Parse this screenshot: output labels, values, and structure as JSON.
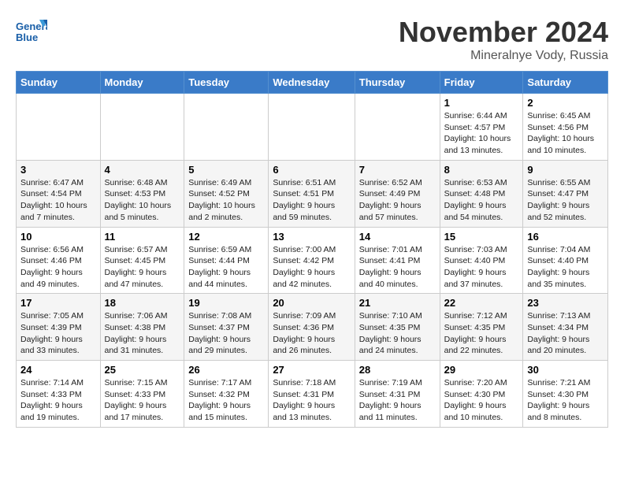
{
  "header": {
    "logo_text_general": "General",
    "logo_text_blue": "Blue",
    "month_title": "November 2024",
    "location": "Mineralnye Vody, Russia"
  },
  "days_of_week": [
    "Sunday",
    "Monday",
    "Tuesday",
    "Wednesday",
    "Thursday",
    "Friday",
    "Saturday"
  ],
  "weeks": [
    [
      {
        "day": "",
        "info": ""
      },
      {
        "day": "",
        "info": ""
      },
      {
        "day": "",
        "info": ""
      },
      {
        "day": "",
        "info": ""
      },
      {
        "day": "",
        "info": ""
      },
      {
        "day": "1",
        "info": "Sunrise: 6:44 AM\nSunset: 4:57 PM\nDaylight: 10 hours and 13 minutes."
      },
      {
        "day": "2",
        "info": "Sunrise: 6:45 AM\nSunset: 4:56 PM\nDaylight: 10 hours and 10 minutes."
      }
    ],
    [
      {
        "day": "3",
        "info": "Sunrise: 6:47 AM\nSunset: 4:54 PM\nDaylight: 10 hours and 7 minutes."
      },
      {
        "day": "4",
        "info": "Sunrise: 6:48 AM\nSunset: 4:53 PM\nDaylight: 10 hours and 5 minutes."
      },
      {
        "day": "5",
        "info": "Sunrise: 6:49 AM\nSunset: 4:52 PM\nDaylight: 10 hours and 2 minutes."
      },
      {
        "day": "6",
        "info": "Sunrise: 6:51 AM\nSunset: 4:51 PM\nDaylight: 9 hours and 59 minutes."
      },
      {
        "day": "7",
        "info": "Sunrise: 6:52 AM\nSunset: 4:49 PM\nDaylight: 9 hours and 57 minutes."
      },
      {
        "day": "8",
        "info": "Sunrise: 6:53 AM\nSunset: 4:48 PM\nDaylight: 9 hours and 54 minutes."
      },
      {
        "day": "9",
        "info": "Sunrise: 6:55 AM\nSunset: 4:47 PM\nDaylight: 9 hours and 52 minutes."
      }
    ],
    [
      {
        "day": "10",
        "info": "Sunrise: 6:56 AM\nSunset: 4:46 PM\nDaylight: 9 hours and 49 minutes."
      },
      {
        "day": "11",
        "info": "Sunrise: 6:57 AM\nSunset: 4:45 PM\nDaylight: 9 hours and 47 minutes."
      },
      {
        "day": "12",
        "info": "Sunrise: 6:59 AM\nSunset: 4:44 PM\nDaylight: 9 hours and 44 minutes."
      },
      {
        "day": "13",
        "info": "Sunrise: 7:00 AM\nSunset: 4:42 PM\nDaylight: 9 hours and 42 minutes."
      },
      {
        "day": "14",
        "info": "Sunrise: 7:01 AM\nSunset: 4:41 PM\nDaylight: 9 hours and 40 minutes."
      },
      {
        "day": "15",
        "info": "Sunrise: 7:03 AM\nSunset: 4:40 PM\nDaylight: 9 hours and 37 minutes."
      },
      {
        "day": "16",
        "info": "Sunrise: 7:04 AM\nSunset: 4:40 PM\nDaylight: 9 hours and 35 minutes."
      }
    ],
    [
      {
        "day": "17",
        "info": "Sunrise: 7:05 AM\nSunset: 4:39 PM\nDaylight: 9 hours and 33 minutes."
      },
      {
        "day": "18",
        "info": "Sunrise: 7:06 AM\nSunset: 4:38 PM\nDaylight: 9 hours and 31 minutes."
      },
      {
        "day": "19",
        "info": "Sunrise: 7:08 AM\nSunset: 4:37 PM\nDaylight: 9 hours and 29 minutes."
      },
      {
        "day": "20",
        "info": "Sunrise: 7:09 AM\nSunset: 4:36 PM\nDaylight: 9 hours and 26 minutes."
      },
      {
        "day": "21",
        "info": "Sunrise: 7:10 AM\nSunset: 4:35 PM\nDaylight: 9 hours and 24 minutes."
      },
      {
        "day": "22",
        "info": "Sunrise: 7:12 AM\nSunset: 4:35 PM\nDaylight: 9 hours and 22 minutes."
      },
      {
        "day": "23",
        "info": "Sunrise: 7:13 AM\nSunset: 4:34 PM\nDaylight: 9 hours and 20 minutes."
      }
    ],
    [
      {
        "day": "24",
        "info": "Sunrise: 7:14 AM\nSunset: 4:33 PM\nDaylight: 9 hours and 19 minutes."
      },
      {
        "day": "25",
        "info": "Sunrise: 7:15 AM\nSunset: 4:33 PM\nDaylight: 9 hours and 17 minutes."
      },
      {
        "day": "26",
        "info": "Sunrise: 7:17 AM\nSunset: 4:32 PM\nDaylight: 9 hours and 15 minutes."
      },
      {
        "day": "27",
        "info": "Sunrise: 7:18 AM\nSunset: 4:31 PM\nDaylight: 9 hours and 13 minutes."
      },
      {
        "day": "28",
        "info": "Sunrise: 7:19 AM\nSunset: 4:31 PM\nDaylight: 9 hours and 11 minutes."
      },
      {
        "day": "29",
        "info": "Sunrise: 7:20 AM\nSunset: 4:30 PM\nDaylight: 9 hours and 10 minutes."
      },
      {
        "day": "30",
        "info": "Sunrise: 7:21 AM\nSunset: 4:30 PM\nDaylight: 9 hours and 8 minutes."
      }
    ]
  ]
}
